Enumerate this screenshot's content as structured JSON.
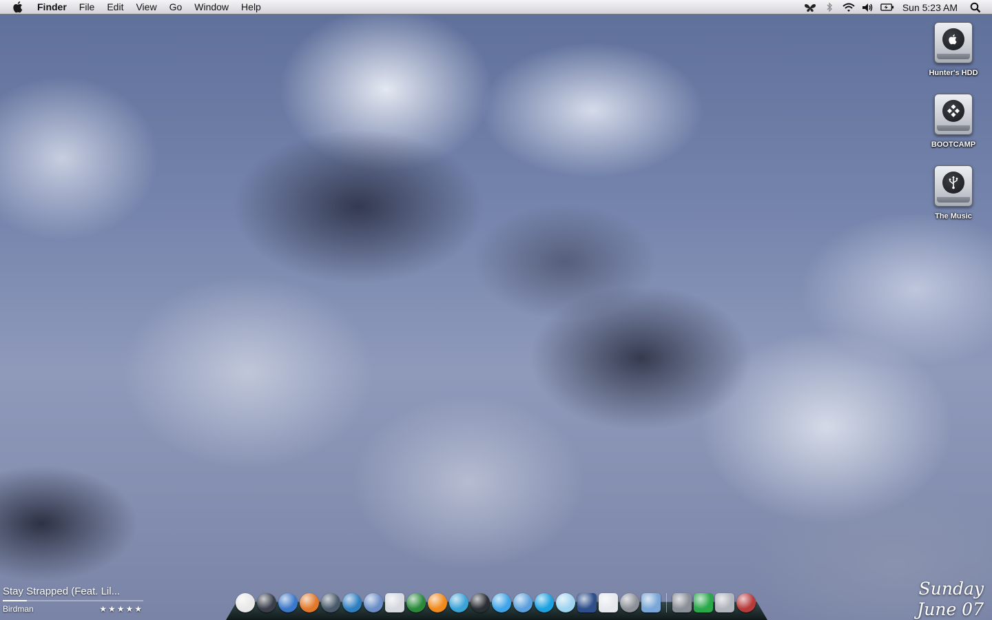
{
  "menubar": {
    "app_name": "Finder",
    "menus": [
      "File",
      "Edit",
      "View",
      "Go",
      "Window",
      "Help"
    ],
    "clock": "Sun 5:23 AM"
  },
  "desktop_icons": [
    {
      "label": "Hunter's HDD",
      "icon": "apple-drive-icon"
    },
    {
      "label": "BOOTCAMP",
      "icon": "windows-drive-icon"
    },
    {
      "label": "The Music",
      "icon": "usb-drive-icon"
    }
  ],
  "now_playing": {
    "title": "Stay Strapped (Feat. Lil...",
    "artist": "Birdman",
    "rating": "★★★★★",
    "progress": 0.17
  },
  "date_widget": {
    "day": "Sunday",
    "date": "June 07"
  },
  "dock": {
    "apps": [
      {
        "name": "finder-icon",
        "color": "#e8e8e8",
        "shape": "round"
      },
      {
        "name": "dashboard-icon",
        "color": "#3a3f4a",
        "shape": "round"
      },
      {
        "name": "safari-icon",
        "color": "#3b78c9",
        "shape": "round"
      },
      {
        "name": "firefox-icon",
        "color": "#e2792a",
        "shape": "round"
      },
      {
        "name": "camino-icon",
        "color": "#4a5a6a",
        "shape": "round"
      },
      {
        "name": "network-globe-icon",
        "color": "#2f7fc0",
        "shape": "round"
      },
      {
        "name": "mail-icon",
        "color": "#6b8ec8",
        "shape": "round"
      },
      {
        "name": "itunes-icon",
        "color": "#d6d9e0",
        "shape": "square"
      },
      {
        "name": "utorrent-icon",
        "color": "#2a8a3a",
        "shape": "round"
      },
      {
        "name": "vlc-icon",
        "color": "#f08a1c",
        "shape": "round"
      },
      {
        "name": "ichat-icon",
        "color": "#3aa3d8",
        "shape": "round"
      },
      {
        "name": "terminal-icon",
        "color": "#2a2f35",
        "shape": "round"
      },
      {
        "name": "frontrow-icon",
        "color": "#3fa5e8",
        "shape": "round"
      },
      {
        "name": "system-globe-icon",
        "color": "#5ba0dc",
        "shape": "round"
      },
      {
        "name": "skype-icon",
        "color": "#1da1e0",
        "shape": "round"
      },
      {
        "name": "paint-icon",
        "color": "#9fd4f0",
        "shape": "round"
      },
      {
        "name": "photoshop-icon",
        "color": "#2e4f8a",
        "shape": "square"
      },
      {
        "name": "archive-icon",
        "color": "#e6e8ee",
        "shape": "square"
      },
      {
        "name": "system-preferences-icon",
        "color": "#8c9098",
        "shape": "round"
      },
      {
        "name": "display-icon",
        "color": "#7aa7d8",
        "shape": "square"
      }
    ],
    "stacks": [
      {
        "name": "applications-folder-icon",
        "color": "#8a8f98"
      },
      {
        "name": "downloads-folder-icon",
        "color": "#2aa84a"
      },
      {
        "name": "documents-folder-icon",
        "color": "#b0b4bc"
      },
      {
        "name": "trash-icon",
        "color": "#b83a3a"
      }
    ]
  }
}
